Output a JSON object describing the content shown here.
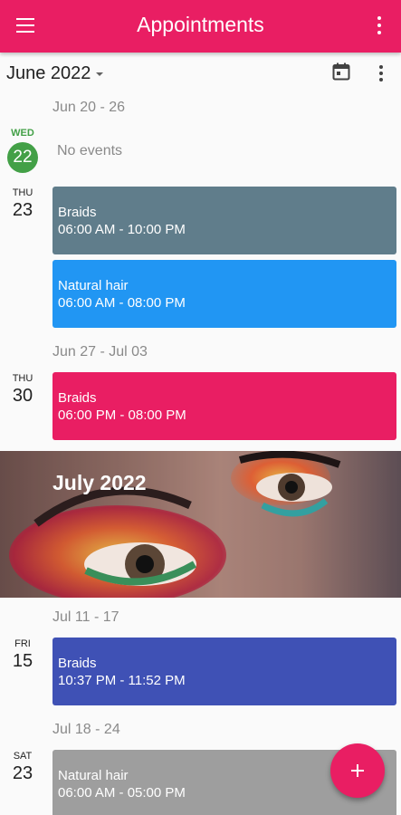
{
  "appbar": {
    "title": "Appointments"
  },
  "subbar": {
    "month": "June 2022"
  },
  "weeks": [
    "Jun 20 - 26",
    "Jun 27 - Jul 03",
    "Jul 11 - 17",
    "Jul 18 - 24"
  ],
  "days": [
    {
      "dow": "WED",
      "num": "22",
      "empty": "No events"
    },
    {
      "dow": "THU",
      "num": "23"
    },
    {
      "dow": "THU",
      "num": "30"
    },
    {
      "dow": "FRI",
      "num": "15"
    },
    {
      "dow": "SAT",
      "num": "23"
    }
  ],
  "events": [
    {
      "title": "Braids",
      "time": "06:00 AM - 10:00 PM",
      "color": "#607d8b"
    },
    {
      "title": "Natural hair",
      "time": "06:00 AM - 08:00 PM",
      "color": "#2196f3"
    },
    {
      "title": "Braids",
      "time": "06:00 PM - 08:00 PM",
      "color": "#e91e63"
    },
    {
      "title": "Braids",
      "time": "10:37 PM - 11:52 PM",
      "color": "#3f51b5"
    },
    {
      "title": "Natural hair",
      "time": "06:00 AM - 05:00 PM",
      "color": "#9e9e9e"
    }
  ],
  "banner": {
    "month": "July 2022"
  },
  "colors": {
    "accent": "#e91e63",
    "today": "#43a047"
  },
  "icons": [
    "menu-icon",
    "more-vert-icon",
    "calendar-icon",
    "plus-icon"
  ]
}
